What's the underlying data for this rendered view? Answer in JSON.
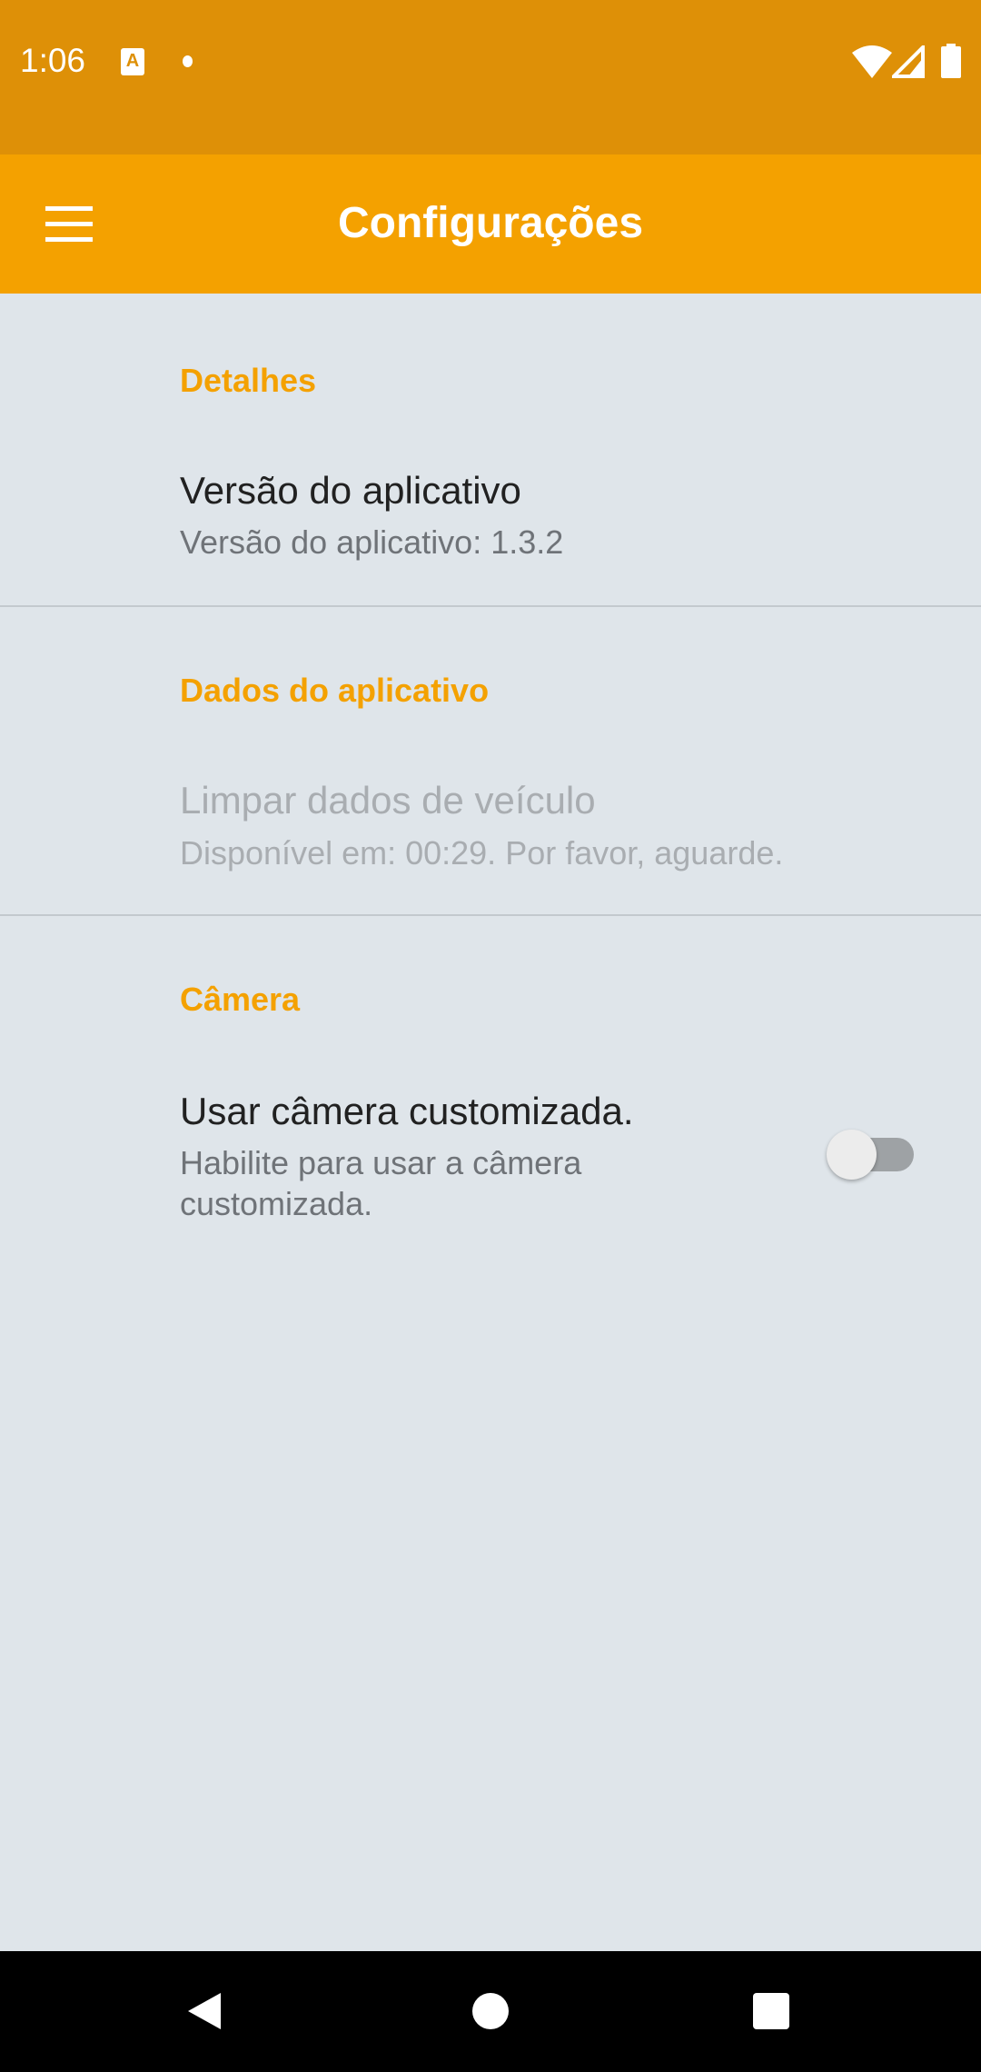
{
  "status_bar": {
    "time": "1:06",
    "notification_icon": "A"
  },
  "toolbar": {
    "title": "Configurações"
  },
  "sections": [
    {
      "category": "Detalhes",
      "title": "Versão do aplicativo",
      "summary": "Versão do aplicativo: 1.3.2"
    },
    {
      "category": "Dados do aplicativo",
      "title": "Limpar dados de veículo",
      "summary": "Disponível em: 00:29. Por favor, aguarde."
    },
    {
      "category": "Câmera",
      "title": "Usar câmera customizada.",
      "summary": "Habilite para usar a câmera customizada.",
      "toggle_on": false
    }
  ],
  "colors": {
    "accent": "#f4a100",
    "status_bar": "#de9007",
    "background": "#dfe5ea"
  }
}
